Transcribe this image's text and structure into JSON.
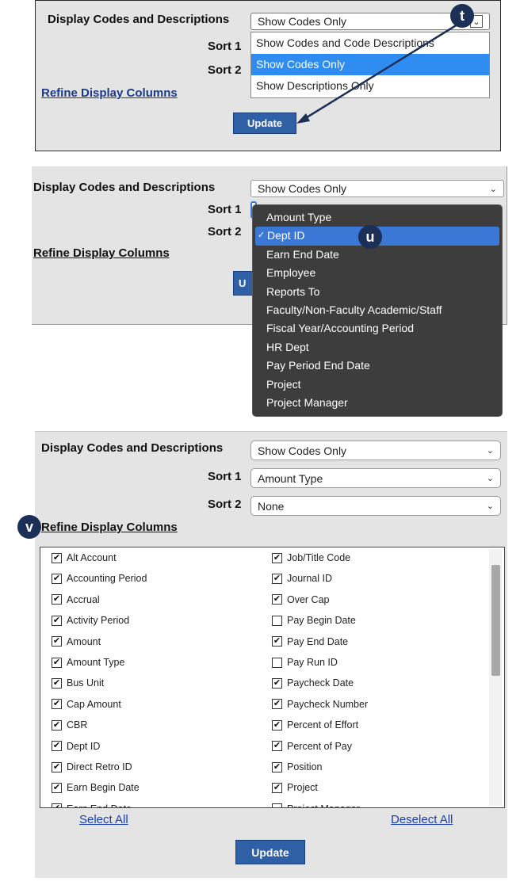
{
  "labels": {
    "display_codes": "Display Codes and Descriptions",
    "sort1": "Sort 1",
    "sort2": "Sort 2",
    "refine": "Refine Display Columns",
    "update": "Update",
    "select_all": "Select All",
    "deselect_all": "Deselect All"
  },
  "callouts": {
    "t": "t",
    "u": "u",
    "v": "v"
  },
  "panel1": {
    "display_value": "Show Codes Only",
    "options": [
      {
        "label": "Show Codes and Code Descriptions",
        "selected": false
      },
      {
        "label": "Show Codes Only",
        "selected": true
      },
      {
        "label": "Show Descriptions Only",
        "selected": false
      }
    ]
  },
  "panel2": {
    "display_value": "Show Codes Only",
    "options": [
      {
        "label": "Amount Type",
        "selected": false
      },
      {
        "label": "Dept ID",
        "selected": true
      },
      {
        "label": "Earn End Date",
        "selected": false
      },
      {
        "label": "Employee",
        "selected": false
      },
      {
        "label": "Reports To",
        "selected": false
      },
      {
        "label": "Faculty/Non-Faculty Academic/Staff",
        "selected": false
      },
      {
        "label": "Fiscal Year/Accounting Period",
        "selected": false
      },
      {
        "label": "HR Dept",
        "selected": false
      },
      {
        "label": "Pay Period End Date",
        "selected": false
      },
      {
        "label": "Project",
        "selected": false
      },
      {
        "label": "Project Manager",
        "selected": false
      }
    ]
  },
  "panel3": {
    "display_value": "Show Codes Only",
    "sort1_value": "Amount Type",
    "sort2_value": "None",
    "columns_left": [
      {
        "label": "Alt Account",
        "checked": true
      },
      {
        "label": "Accounting Period",
        "checked": true
      },
      {
        "label": "Accrual",
        "checked": true
      },
      {
        "label": "Activity Period",
        "checked": true
      },
      {
        "label": "Amount",
        "checked": true
      },
      {
        "label": "Amount Type",
        "checked": true
      },
      {
        "label": "Bus Unit",
        "checked": true
      },
      {
        "label": "Cap Amount",
        "checked": true
      },
      {
        "label": "CBR",
        "checked": true
      },
      {
        "label": "Dept ID",
        "checked": true
      },
      {
        "label": "Direct Retro ID",
        "checked": true
      },
      {
        "label": "Earn Begin Date",
        "checked": true
      },
      {
        "label": "Earn End Date",
        "checked": true
      }
    ],
    "columns_right": [
      {
        "label": "Job/Title Code",
        "checked": true
      },
      {
        "label": "Journal ID",
        "checked": true
      },
      {
        "label": "Over Cap",
        "checked": true
      },
      {
        "label": "Pay Begin Date",
        "checked": false
      },
      {
        "label": "Pay End Date",
        "checked": true
      },
      {
        "label": "Pay Run ID",
        "checked": false
      },
      {
        "label": "Paycheck Date",
        "checked": true
      },
      {
        "label": "Paycheck Number",
        "checked": true
      },
      {
        "label": "Percent of Effort",
        "checked": true
      },
      {
        "label": "Percent of Pay",
        "checked": true
      },
      {
        "label": "Position",
        "checked": true
      },
      {
        "label": "Project",
        "checked": true
      },
      {
        "label": "Project Manager",
        "checked": false
      }
    ]
  },
  "colors": {
    "panel": "#e4e4e4",
    "button": "#2f5fa5",
    "callout": "#1b2f57",
    "highlight": "#2f8cf0"
  }
}
